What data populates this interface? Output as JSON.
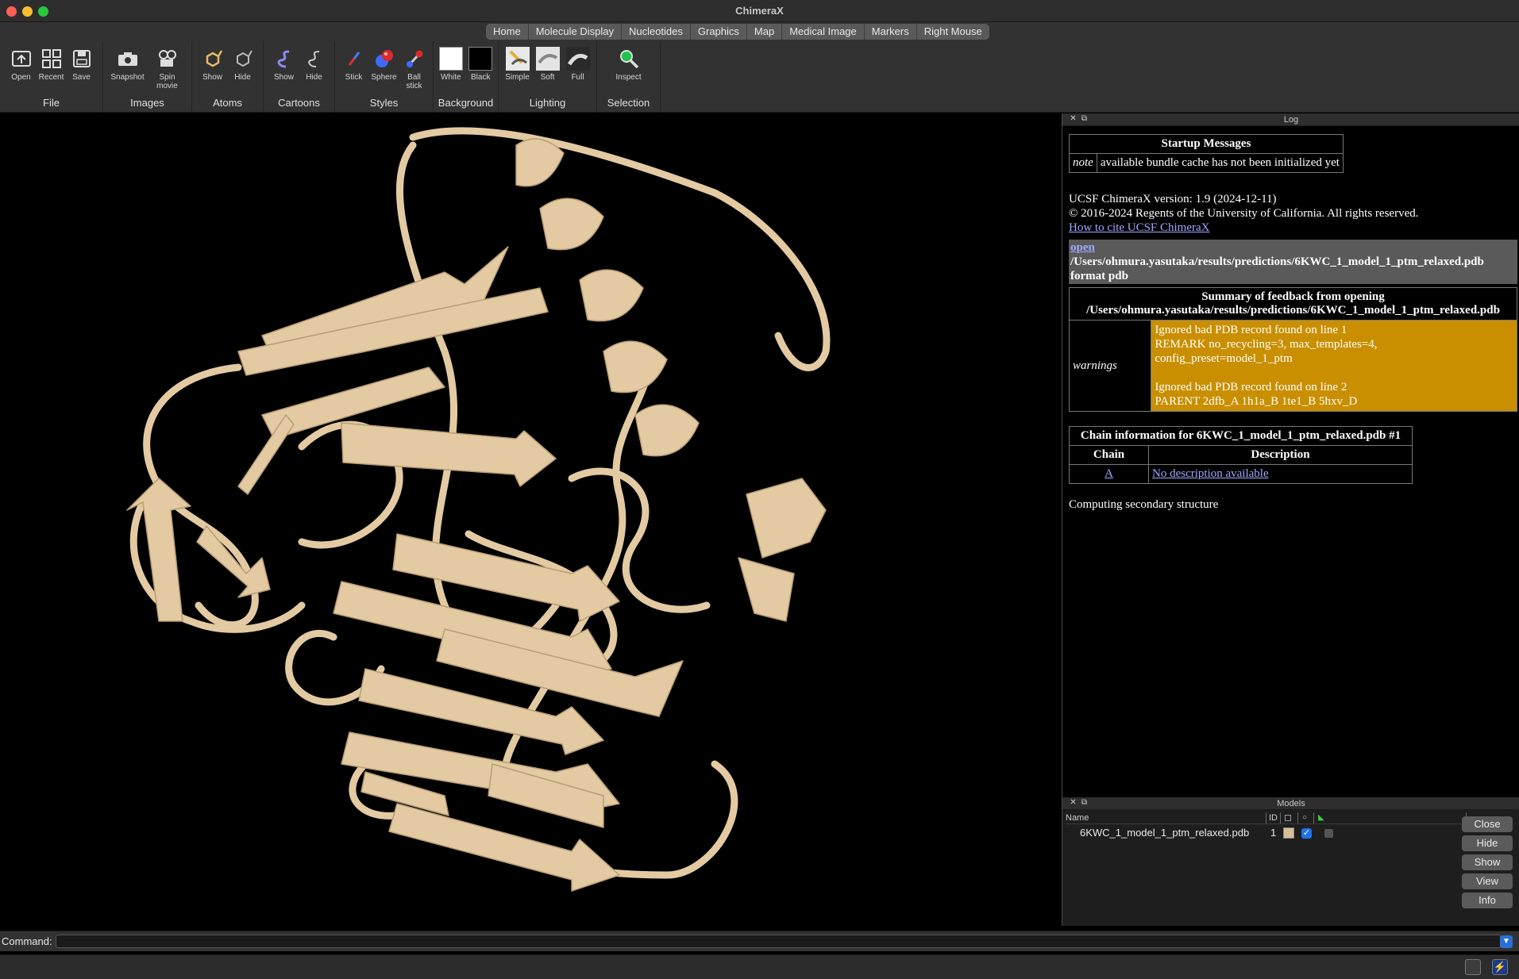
{
  "window": {
    "title": "ChimeraX"
  },
  "tabs": [
    "Home",
    "Molecule Display",
    "Nucleotides",
    "Graphics",
    "Map",
    "Medical Image",
    "Markers",
    "Right Mouse"
  ],
  "toolbar": {
    "groups": [
      {
        "label": "File",
        "tools": [
          {
            "label": "Open",
            "icon": "open-icon"
          },
          {
            "label": "Recent",
            "icon": "recent-icon"
          },
          {
            "label": "Save",
            "icon": "save-icon"
          }
        ]
      },
      {
        "label": "Images",
        "tools": [
          {
            "label": "Snapshot",
            "icon": "camera-icon"
          },
          {
            "label": "Spin movie",
            "icon": "film-icon"
          }
        ]
      },
      {
        "label": "Atoms",
        "tools": [
          {
            "label": "Show",
            "icon": "atoms-show-icon"
          },
          {
            "label": "Hide",
            "icon": "atoms-hide-icon"
          }
        ]
      },
      {
        "label": "Cartoons",
        "tools": [
          {
            "label": "Show",
            "icon": "cartoon-show-icon"
          },
          {
            "label": "Hide",
            "icon": "cartoon-hide-icon"
          }
        ]
      },
      {
        "label": "Styles",
        "tools": [
          {
            "label": "Stick",
            "icon": "stick-icon"
          },
          {
            "label": "Sphere",
            "icon": "sphere-icon"
          },
          {
            "label": "Ball stick",
            "icon": "ball-stick-icon"
          }
        ]
      },
      {
        "label": "Background",
        "tools": [
          {
            "label": "White",
            "icon": "white-swatch-icon"
          },
          {
            "label": "Black",
            "icon": "black-swatch-icon"
          }
        ]
      },
      {
        "label": "Lighting",
        "tools": [
          {
            "label": "Simple",
            "icon": "lighting-simple-icon"
          },
          {
            "label": "Soft",
            "icon": "lighting-soft-icon"
          },
          {
            "label": "Full",
            "icon": "lighting-full-icon"
          }
        ]
      },
      {
        "label": "Selection",
        "tools": [
          {
            "label": "Inspect",
            "icon": "magnifier-icon"
          }
        ]
      }
    ]
  },
  "log": {
    "title": "Log",
    "startup_header": "Startup Messages",
    "startup_note_label": "note",
    "startup_note_text": "available bundle cache has not been initialized yet",
    "version_line": "UCSF ChimeraX version: 1.9 (2024-12-11)",
    "copyright_line": "© 2016-2024 Regents of the University of California. All rights reserved.",
    "cite_link": "How to cite UCSF ChimeraX",
    "cmd_link": "open",
    "cmd_path": "/Users/ohmura.yasutaka/results/predictions/6KWC_1_model_1_ptm_relaxed.pdb",
    "cmd_format": "format pdb",
    "summary_title": "Summary of feedback from opening",
    "summary_path": "/Users/ohmura.yasutaka/results/predictions/6KWC_1_model_1_ptm_relaxed.pdb",
    "warnings_label": "warnings",
    "warning_lines_1": [
      "Ignored bad PDB record found on line 1",
      "REMARK no_recycling=3, max_templates=4,",
      "config_preset=model_1_ptm"
    ],
    "warning_lines_2": [
      "Ignored bad PDB record found on line 2",
      "PARENT 2dfb_A 1h1a_B 1te1_B 5hxv_D"
    ],
    "chain_title": "Chain information for 6KWC_1_model_1_ptm_relaxed.pdb #1",
    "chain_col_chain": "Chain",
    "chain_col_desc": "Description",
    "chain_id": "A",
    "chain_desc": "No description available",
    "computing": "Computing secondary structure"
  },
  "models": {
    "title": "Models",
    "columns": {
      "name": "Name",
      "id": "ID"
    },
    "rows": [
      {
        "name": "6KWC_1_model_1_ptm_relaxed.pdb",
        "id": "1",
        "color": "#d8bd97",
        "shown": true
      }
    ],
    "buttons": [
      "Close",
      "Hide",
      "Show",
      "View",
      "Info"
    ]
  },
  "command": {
    "label": "Command:",
    "value": ""
  },
  "colors": {
    "ribbon": "#e3caa2",
    "ribbon_shade": "#b89d74",
    "warning_bg": "#c98f00",
    "link": "#9fa8ff"
  }
}
